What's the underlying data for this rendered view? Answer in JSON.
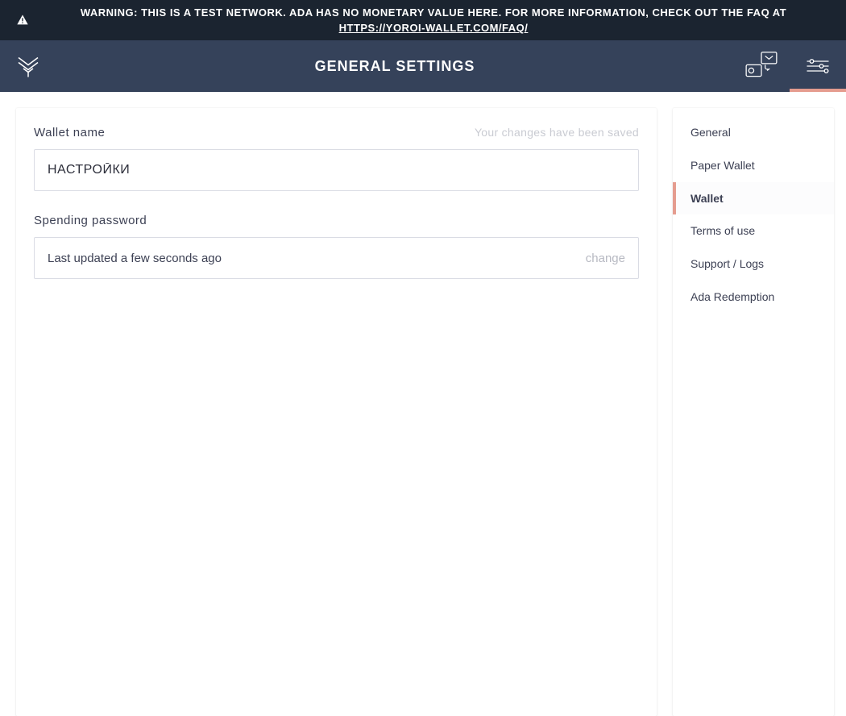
{
  "warning": {
    "text_prefix": "WARNING: THIS IS A TEST NETWORK. ADA HAS NO MONETARY VALUE HERE. FOR MORE INFORMATION, CHECK OUT THE FAQ AT ",
    "link_text": "HTTPS://YOROI-WALLET.COM/FAQ/"
  },
  "header": {
    "title": "GENERAL SETTINGS",
    "icons": {
      "logo": "yoroi-logo",
      "wallets": "wallets-stack-icon",
      "settings": "settings-sliders-icon"
    }
  },
  "form": {
    "wallet_name": {
      "label": "Wallet name",
      "value": "НАСТРОЙКИ",
      "saved_msg": "Your changes have been saved"
    },
    "spending_password": {
      "label": "Spending password",
      "status": "Last updated a few seconds ago",
      "change_label": "change"
    }
  },
  "sidebar": {
    "items": [
      {
        "label": "General",
        "active": false
      },
      {
        "label": "Paper Wallet",
        "active": false
      },
      {
        "label": "Wallet",
        "active": true
      },
      {
        "label": "Terms of use",
        "active": false
      },
      {
        "label": "Support / Logs",
        "active": false
      },
      {
        "label": "Ada Redemption",
        "active": false
      }
    ]
  },
  "colors": {
    "banner_bg": "#1B2430",
    "topbar_bg": "#35425A",
    "accent": "#E59C8F",
    "text_dark": "#3D4154",
    "border": "#DADCE4",
    "muted": "#C9CBD2"
  }
}
